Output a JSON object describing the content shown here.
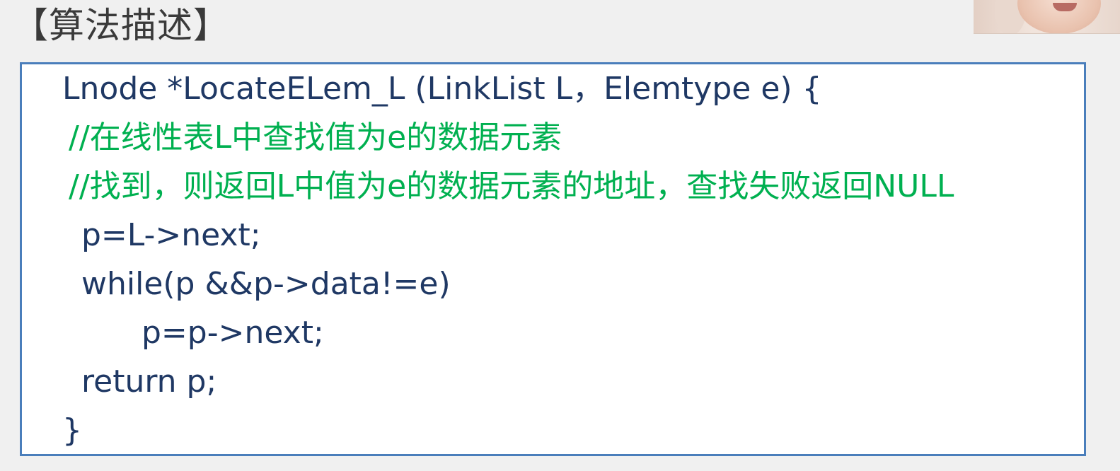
{
  "slide": {
    "title": "【算法描述】"
  },
  "webcam": {
    "icon": "presenter-video-thumbnail"
  },
  "code": {
    "lines": [
      "Lnode *LocateELem_L (LinkList L，Elemtype e) {",
      "//在线性表L中查找值为e的数据元素",
      "//找到，则返回L中值为e的数据元素的地址，查找失败返回NULL",
      "p=L->next;",
      "while(p &&p->data!=e)",
      "p=p->next;",
      "return p;",
      "}"
    ],
    "colors": {
      "code_text": "#1f3864",
      "comment_text": "#00b050",
      "box_border": "#4a7ebb"
    }
  }
}
